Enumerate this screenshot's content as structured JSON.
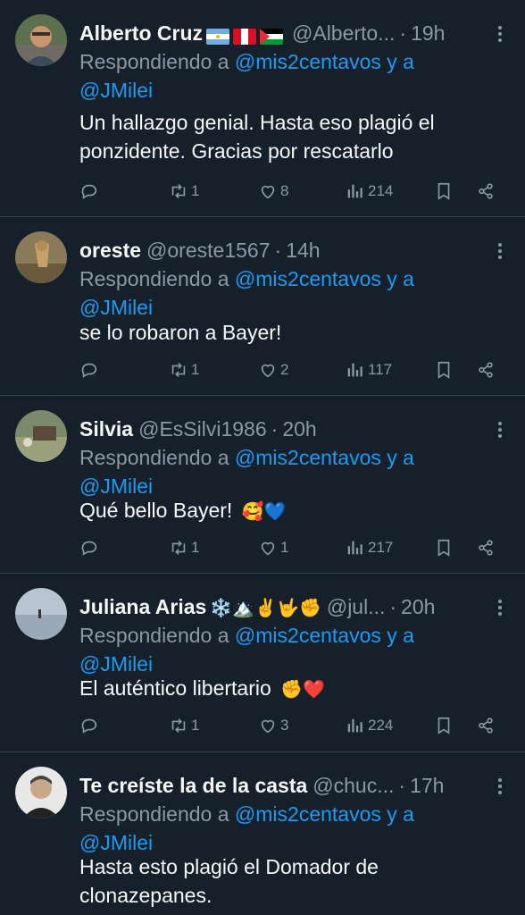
{
  "tweets": [
    {
      "name": "Alberto Cruz",
      "handle": "@Alberto...",
      "time": "19h",
      "reply_prefix": "Respondiendo a",
      "reply_to": "@mis2centavos",
      "reply_and": "y a",
      "reply_to2": "@JMilei",
      "text": "Un hallazgo genial.  Hasta eso plagió el ponzidente.  Gracias por rescatarlo",
      "retweets": "1",
      "likes": "8",
      "views": "214"
    },
    {
      "name": "oreste",
      "handle": "@oreste1567",
      "time": "14h",
      "reply_prefix": "Respondiendo a",
      "reply_to": "@mis2centavos",
      "reply_and": "y a",
      "reply_to2": "@JMilei",
      "text": "se lo robaron a Bayer!",
      "retweets": "1",
      "likes": "2",
      "views": "117"
    },
    {
      "name": "Silvia",
      "handle": "@EsSilvi1986",
      "time": "20h",
      "reply_prefix": "Respondiendo a",
      "reply_to": "@mis2centavos",
      "reply_and": "y a",
      "reply_to2": "@JMilei",
      "text": "Qué bello Bayer!",
      "text_emoji": "🥰💙",
      "retweets": "1",
      "likes": "1",
      "views": "217"
    },
    {
      "name": "Juliana Arias",
      "name_emoji": "❄️🏔️✌️🤟✊",
      "handle": "@jul...",
      "time": "20h",
      "reply_prefix": "Respondiendo a",
      "reply_to": "@mis2centavos",
      "reply_and": "y a",
      "reply_to2": "@JMilei",
      "text": "El auténtico libertario",
      "text_emoji": "✊❤️",
      "retweets": "1",
      "likes": "3",
      "views": "224"
    },
    {
      "name": "Te creíste la de la casta",
      "handle": "@chuc...",
      "time": "17h",
      "reply_prefix": "Respondiendo a",
      "reply_to": "@mis2centavos",
      "reply_and": "y a",
      "reply_to2": "@JMilei",
      "text": "Hasta esto plagió el Domador de clonazepanes."
    }
  ],
  "separator": "·",
  "colors": {
    "background": "#15202b",
    "muted": "#8b98a5",
    "link": "#1d9bf0",
    "divider": "#38444d"
  },
  "icons": [
    "more-icon",
    "reply-icon",
    "retweet-icon",
    "like-icon",
    "views-icon",
    "bookmark-icon",
    "share-icon"
  ]
}
